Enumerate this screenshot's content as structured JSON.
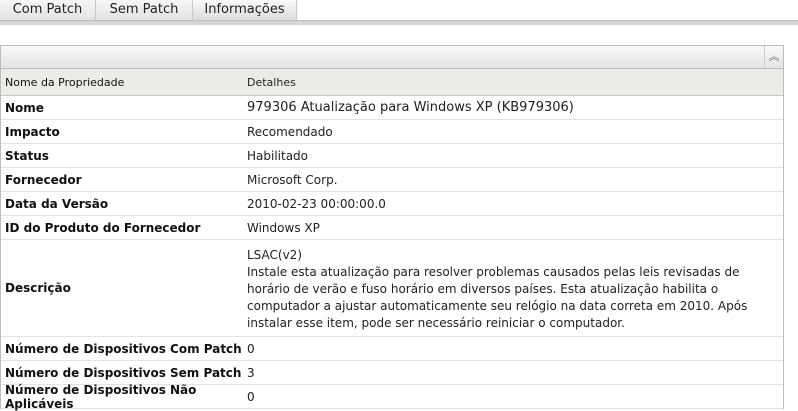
{
  "tabs": [
    "Com Patch",
    "Sem Patch",
    "Informações"
  ],
  "table": {
    "headers": [
      "Nome da Propriedade",
      "Detalhes"
    ],
    "rows": [
      {
        "label": "Nome",
        "value": "979306 Atualização para Windows XP (KB979306)"
      },
      {
        "label": "Impacto",
        "value": "Recomendado"
      },
      {
        "label": "Status",
        "value": "Habilitado"
      },
      {
        "label": "Fornecedor",
        "value": "Microsoft Corp."
      },
      {
        "label": "Data da Versão",
        "value": "2010-02-23 00:00:00.0"
      },
      {
        "label": "ID do Produto do Fornecedor",
        "value": "Windows XP"
      }
    ],
    "description": {
      "label": "Descrição",
      "title": "LSAC(v2)",
      "text": "Instale esta atualização para resolver problemas causados pelas leis revisadas de horário de verão e fuso horário em diversos países. Esta atualização habilita o computador a ajustar automaticamente seu relógio na data correta em 2010. Após instalar esse item, pode ser necessário reiniciar o computador."
    },
    "counts": [
      {
        "label": "Número de Dispositivos Com Patch",
        "value": "0"
      },
      {
        "label": "Número de Dispositivos Sem Patch",
        "value": "3"
      },
      {
        "label": "Número de Dispositivos Não Aplicáveis",
        "value": "0"
      }
    ]
  }
}
